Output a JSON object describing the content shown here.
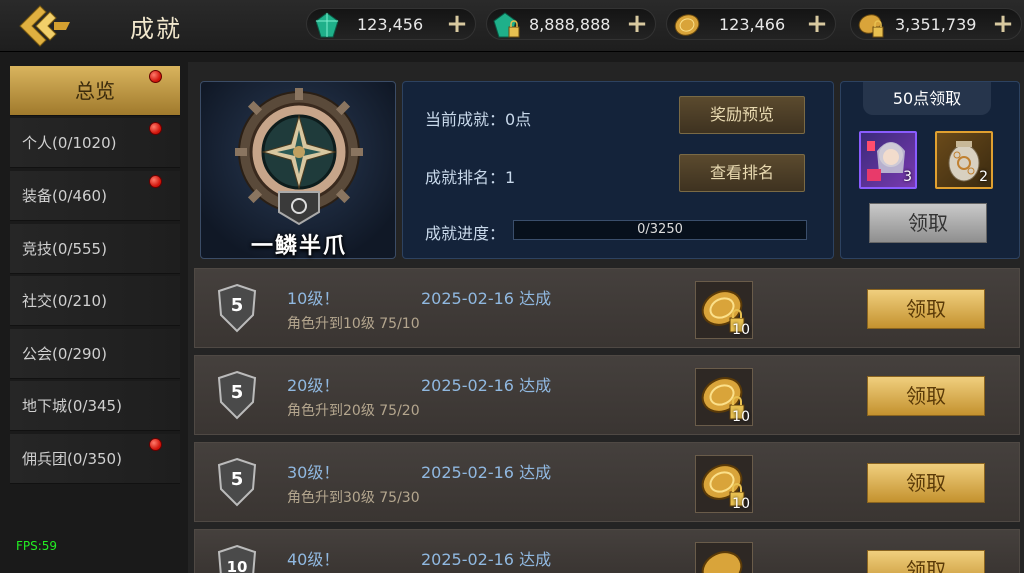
{
  "header": {
    "title": "成就",
    "currencies": [
      {
        "icon": "green-gem-icon",
        "value": "123,456"
      },
      {
        "icon": "locked-green-gem-icon",
        "value": "8,888,888"
      },
      {
        "icon": "gold-coin-icon",
        "value": "123,466"
      },
      {
        "icon": "locked-gold-coin-icon",
        "value": "3,351,739"
      }
    ]
  },
  "sidebar": {
    "items": [
      {
        "label": "总览",
        "active": true,
        "dot": true
      },
      {
        "label": "个人(0/1020)",
        "dot": true
      },
      {
        "label": "装备(0/460)",
        "dot": true
      },
      {
        "label": "竞技(0/555)",
        "dot": false
      },
      {
        "label": "社交(0/210)",
        "dot": false
      },
      {
        "label": "公会(0/290)",
        "dot": false
      },
      {
        "label": "地下城(0/345)",
        "dot": false
      },
      {
        "label": "佣兵团(0/350)",
        "dot": true
      }
    ],
    "fps": "FPS:59"
  },
  "summary": {
    "rank_title": "一鳞半爪",
    "current_label": "当前成就：0点",
    "rank_label": "成就排名：1",
    "progress_label": "成就进度：",
    "progress_text": "0/3250",
    "progress_fraction": 0,
    "preview_button": "奖励预览",
    "ranking_button": "查看排名"
  },
  "milestone": {
    "header": "50点领取",
    "items": [
      {
        "icon": "hero-portrait-icon",
        "count": "3"
      },
      {
        "icon": "treasure-urn-icon",
        "count": "2"
      }
    ],
    "claim_button": "领取"
  },
  "achievements": [
    {
      "badge": "5",
      "title": "10级！",
      "date": "2025-02-16 达成",
      "desc": "角色升到10级 75/10",
      "reward_icon": "locked-gold-coin-icon",
      "reward_count": "10",
      "claim": "领取"
    },
    {
      "badge": "5",
      "title": "20级！",
      "date": "2025-02-16 达成",
      "desc": "角色升到20级 75/20",
      "reward_icon": "locked-gold-coin-icon",
      "reward_count": "10",
      "claim": "领取"
    },
    {
      "badge": "5",
      "title": "30级！",
      "date": "2025-02-16 达成",
      "desc": "角色升到30级 75/30",
      "reward_icon": "locked-gold-coin-icon",
      "reward_count": "10",
      "claim": "领取"
    },
    {
      "badge": "10",
      "title": "40级！",
      "date": "2025-02-16 达成",
      "desc": "",
      "reward_icon": "locked-gold-coin-icon",
      "reward_count": "",
      "claim": "领取"
    }
  ],
  "colors": {
    "gold_button": "#e0b45a",
    "title_blue": "#90b8e0",
    "panel_navy": "#14233a",
    "fps_green": "#22ee22"
  }
}
